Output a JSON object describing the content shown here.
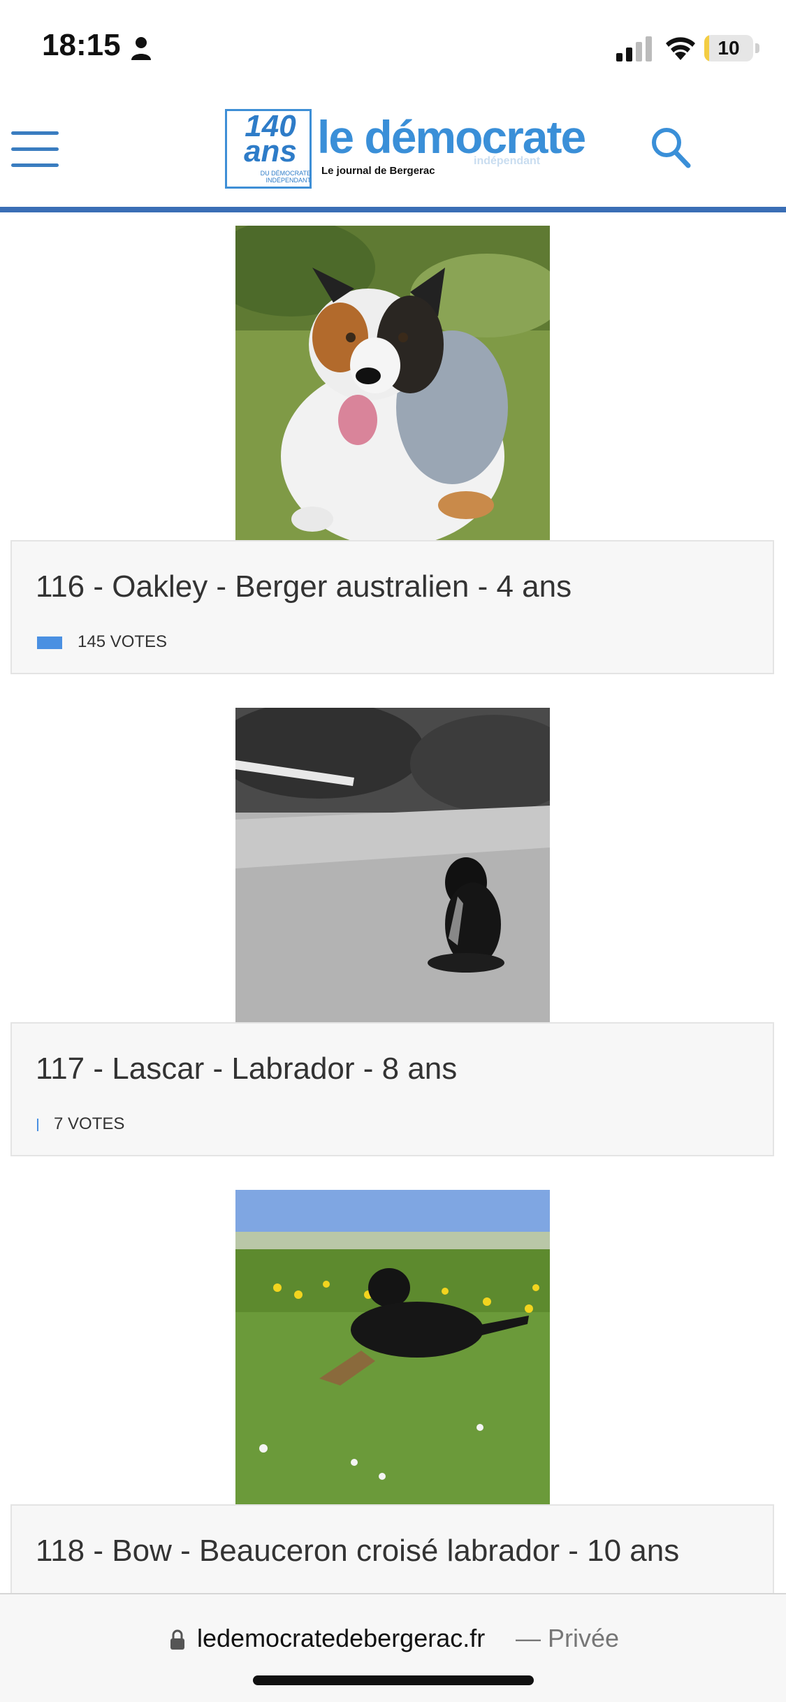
{
  "status_bar": {
    "time": "18:15",
    "battery_percent": "10",
    "battery_level": 0.1,
    "person_icon": "person-icon",
    "signal_icon": "cellular-signal-icon",
    "wifi_icon": "wifi-icon"
  },
  "header": {
    "logo": {
      "badge_number": "140",
      "badge_word": "ans",
      "badge_small": "DU DÉMOCRATE INDÉPENDANT",
      "title": "le démocrate",
      "tagline": "indépendant",
      "subtitle": "Le journal de Bergerac"
    },
    "menu_icon": "hamburger-menu-icon",
    "search_icon": "search-icon",
    "colors": {
      "brand_blue": "#3a8fd8",
      "rule_blue": "#3a6eb5"
    }
  },
  "entries": [
    {
      "title": "116 - Oakley - Berger australien - 4 ans",
      "votes": 145,
      "votes_label": "145 VOTES"
    },
    {
      "title": "117 - Lascar - Labrador - 8 ans",
      "votes": 7,
      "votes_label": "7 VOTES"
    },
    {
      "title": "118 - Bow - Beauceron croisé labrador - 10 ans"
    }
  ],
  "vote_bar_color": "#4a90e2",
  "address_bar": {
    "url": "ledemocratedebergerac.fr",
    "privacy": "— Privée",
    "lock_icon": "lock-icon"
  }
}
